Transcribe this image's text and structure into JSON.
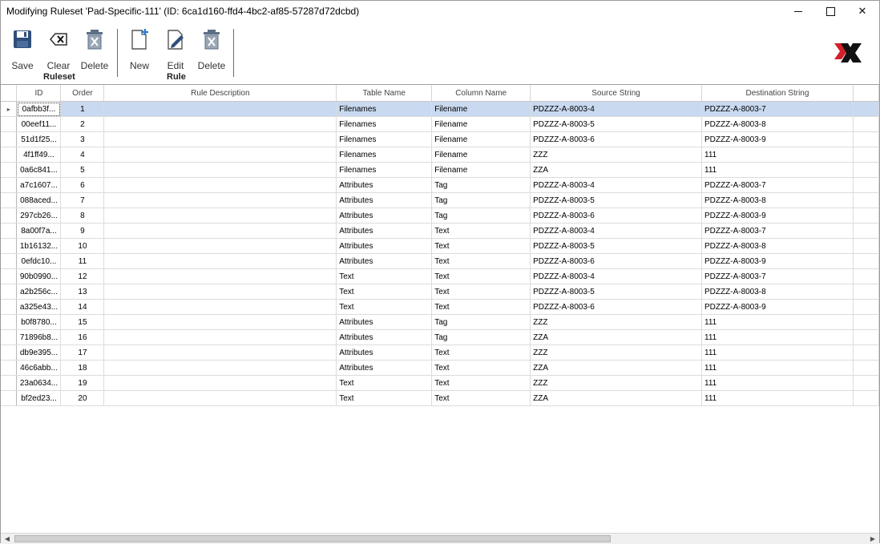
{
  "window": {
    "title": "Modifying Ruleset 'Pad-Specific-111' (ID: 6ca1d160-ffd4-4bc2-af85-57287d72dcbd)"
  },
  "toolbar": {
    "ruleset_group": "Ruleset",
    "rule_group": "Rule",
    "save_label": "Save",
    "clear_label": "Clear",
    "delete_ruleset_label": "Delete",
    "new_label": "New",
    "edit_label": "Edit",
    "delete_rule_label": "Delete"
  },
  "grid": {
    "columns": [
      "ID",
      "Order",
      "Rule Description",
      "Table Name",
      "Column Name",
      "Source String",
      "Destination String"
    ],
    "rows": [
      {
        "id": "0afbb3f...",
        "order": "1",
        "desc": "",
        "table": "Filenames",
        "column": "Filename",
        "source": "PDZZZ-A-8003-4",
        "dest": "PDZZZ-A-8003-7"
      },
      {
        "id": "00eef11...",
        "order": "2",
        "desc": "",
        "table": "Filenames",
        "column": "Filename",
        "source": "PDZZZ-A-8003-5",
        "dest": "PDZZZ-A-8003-8"
      },
      {
        "id": "51d1f25...",
        "order": "3",
        "desc": "",
        "table": "Filenames",
        "column": "Filename",
        "source": "PDZZZ-A-8003-6",
        "dest": "PDZZZ-A-8003-9"
      },
      {
        "id": "4f1ff49...",
        "order": "4",
        "desc": "",
        "table": "Filenames",
        "column": "Filename",
        "source": "ZZZ",
        "dest": "111"
      },
      {
        "id": "0a6c841...",
        "order": "5",
        "desc": "",
        "table": "Filenames",
        "column": "Filename",
        "source": "ZZA",
        "dest": "111"
      },
      {
        "id": "a7c1607...",
        "order": "6",
        "desc": "",
        "table": "Attributes",
        "column": "Tag",
        "source": "PDZZZ-A-8003-4",
        "dest": "PDZZZ-A-8003-7"
      },
      {
        "id": "088aced...",
        "order": "7",
        "desc": "",
        "table": "Attributes",
        "column": "Tag",
        "source": "PDZZZ-A-8003-5",
        "dest": "PDZZZ-A-8003-8"
      },
      {
        "id": "297cb26...",
        "order": "8",
        "desc": "",
        "table": "Attributes",
        "column": "Tag",
        "source": "PDZZZ-A-8003-6",
        "dest": "PDZZZ-A-8003-9"
      },
      {
        "id": "8a00f7a...",
        "order": "9",
        "desc": "",
        "table": "Attributes",
        "column": "Text",
        "source": "PDZZZ-A-8003-4",
        "dest": "PDZZZ-A-8003-7"
      },
      {
        "id": "1b16132...",
        "order": "10",
        "desc": "",
        "table": "Attributes",
        "column": "Text",
        "source": "PDZZZ-A-8003-5",
        "dest": "PDZZZ-A-8003-8"
      },
      {
        "id": "0efdc10...",
        "order": "11",
        "desc": "",
        "table": "Attributes",
        "column": "Text",
        "source": "PDZZZ-A-8003-6",
        "dest": "PDZZZ-A-8003-9"
      },
      {
        "id": "90b0990...",
        "order": "12",
        "desc": "",
        "table": "Text",
        "column": "Text",
        "source": "PDZZZ-A-8003-4",
        "dest": "PDZZZ-A-8003-7"
      },
      {
        "id": "a2b256c...",
        "order": "13",
        "desc": "",
        "table": "Text",
        "column": "Text",
        "source": "PDZZZ-A-8003-5",
        "dest": "PDZZZ-A-8003-8"
      },
      {
        "id": "a325e43...",
        "order": "14",
        "desc": "",
        "table": "Text",
        "column": "Text",
        "source": "PDZZZ-A-8003-6",
        "dest": "PDZZZ-A-8003-9"
      },
      {
        "id": "b0f8780...",
        "order": "15",
        "desc": "",
        "table": "Attributes",
        "column": "Tag",
        "source": "ZZZ",
        "dest": "111"
      },
      {
        "id": "71896b8...",
        "order": "16",
        "desc": "",
        "table": "Attributes",
        "column": "Tag",
        "source": "ZZA",
        "dest": "111"
      },
      {
        "id": "db9e395...",
        "order": "17",
        "desc": "",
        "table": "Attributes",
        "column": "Text",
        "source": "ZZZ",
        "dest": "111"
      },
      {
        "id": "46c6abb...",
        "order": "18",
        "desc": "",
        "table": "Attributes",
        "column": "Text",
        "source": "ZZA",
        "dest": "111"
      },
      {
        "id": "23a0634...",
        "order": "19",
        "desc": "",
        "table": "Text",
        "column": "Text",
        "source": "ZZZ",
        "dest": "111"
      },
      {
        "id": "bf2ed23...",
        "order": "20",
        "desc": "",
        "table": "Text",
        "column": "Text",
        "source": "ZZA",
        "dest": "111"
      }
    ],
    "selected_row_marker": "▸"
  },
  "icons": {
    "save": "save-icon",
    "clear": "clear-icon",
    "delete": "trash-icon",
    "new": "new-document-icon",
    "edit": "edit-icon",
    "logo": "app-logo"
  },
  "colors": {
    "selection": "#c8d9f0",
    "logo_red": "#d3202a",
    "logo_black": "#111111"
  }
}
